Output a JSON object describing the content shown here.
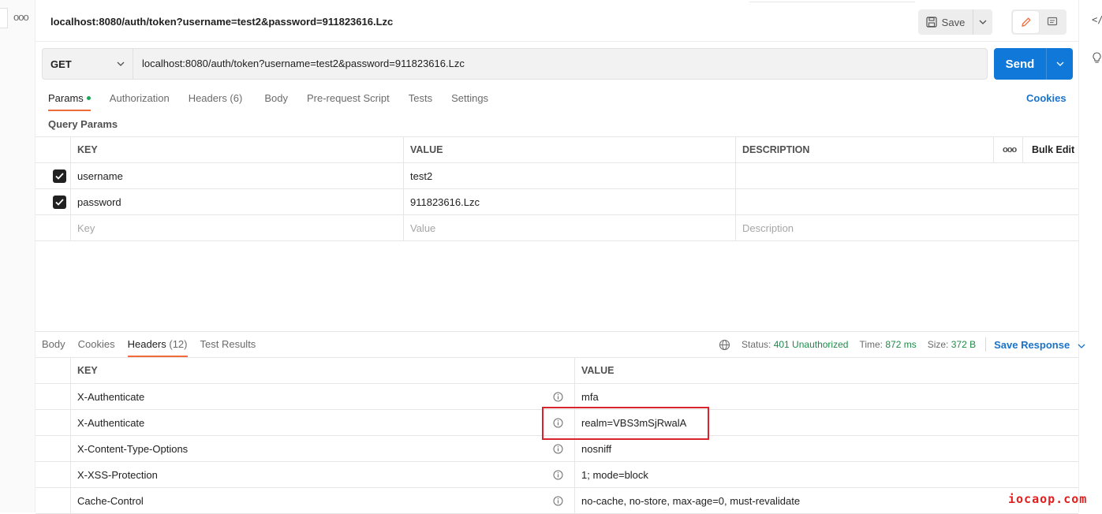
{
  "header": {
    "title": "localhost:8080/auth/token?username=test2&password=911823616.Lzc",
    "save_label": "Save"
  },
  "request": {
    "method": "GET",
    "url": "localhost:8080/auth/token?username=test2&password=911823616.Lzc",
    "send_label": "Send"
  },
  "request_tabs": [
    {
      "label": "Params",
      "active": true
    },
    {
      "label": "Authorization"
    },
    {
      "label": "Headers (6)"
    },
    {
      "label": "Body"
    },
    {
      "label": "Pre-request Script"
    },
    {
      "label": "Tests"
    },
    {
      "label": "Settings"
    }
  ],
  "cookies_label": "Cookies",
  "query_params": {
    "title": "Query Params",
    "columns": {
      "key": "KEY",
      "value": "VALUE",
      "description": "DESCRIPTION",
      "bulk_edit": "Bulk Edit",
      "more": "ooo"
    },
    "rows": [
      {
        "key": "username",
        "value": "test2",
        "checked": true
      },
      {
        "key": "password",
        "value": "911823616.Lzc",
        "checked": true
      }
    ],
    "placeholders": {
      "key": "Key",
      "value": "Value",
      "description": "Description"
    }
  },
  "response_tabs": [
    {
      "label": "Body"
    },
    {
      "label": "Cookies"
    },
    {
      "label": "Headers",
      "count": "(12)",
      "active": true
    },
    {
      "label": "Test Results"
    }
  ],
  "status": {
    "status_label": "Status:",
    "status_value": "401 Unauthorized",
    "time_label": "Time:",
    "time_value": "872 ms",
    "size_label": "Size:",
    "size_value": "372 B",
    "save_response": "Save Response"
  },
  "response_headers": {
    "columns": {
      "key": "KEY",
      "value": "VALUE"
    },
    "rows": [
      {
        "key": "X-Authenticate",
        "value": "mfa"
      },
      {
        "key": "X-Authenticate",
        "value": "realm=VBS3mSjRwalA"
      },
      {
        "key": "X-Content-Type-Options",
        "value": "nosniff"
      },
      {
        "key": "X-XSS-Protection",
        "value": "1; mode=block"
      },
      {
        "key": "Cache-Control",
        "value": "no-cache, no-store, max-age=0, must-revalidate"
      }
    ]
  },
  "left_strip": {
    "more": "ooo"
  },
  "right_strip": {
    "code": "</"
  },
  "watermark": "iocaop.com",
  "colors": {
    "accent": "#f26b3a",
    "send": "#0f78d9",
    "link": "#1a73c9",
    "status_ok": "#1e8a4a",
    "highlight": "#d9232d"
  }
}
